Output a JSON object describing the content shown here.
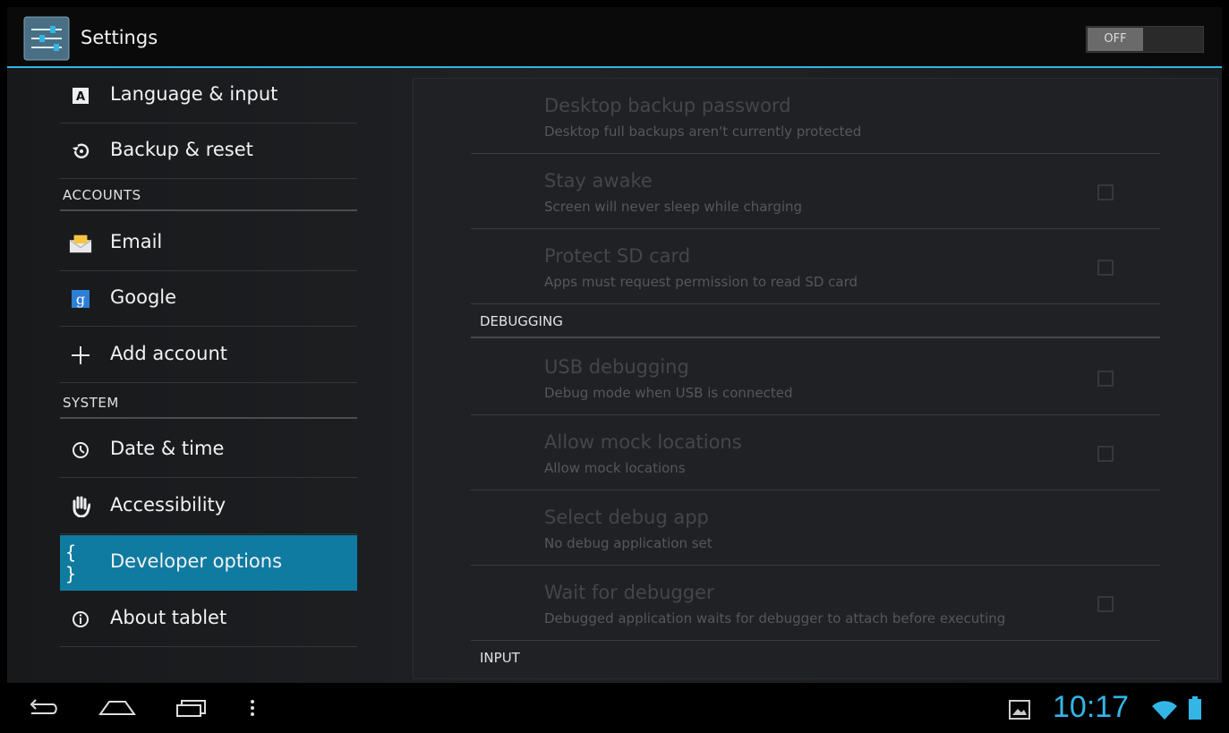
{
  "app": {
    "title": "Settings",
    "master_switch": "OFF"
  },
  "sidebar": {
    "items": [
      {
        "label": "Language & input",
        "icon": "language-icon"
      },
      {
        "label": "Backup & reset",
        "icon": "backup-icon"
      },
      {
        "header": "ACCOUNTS"
      },
      {
        "label": "Email",
        "icon": "email-icon"
      },
      {
        "label": "Google",
        "icon": "google-icon"
      },
      {
        "label": "Add account",
        "icon": "plus-icon"
      },
      {
        "header": "SYSTEM"
      },
      {
        "label": "Date & time",
        "icon": "clock-icon"
      },
      {
        "label": "Accessibility",
        "icon": "hand-icon"
      },
      {
        "label": "Developer options",
        "icon": "braces-icon",
        "selected": true
      },
      {
        "label": "About tablet",
        "icon": "info-icon"
      }
    ]
  },
  "detail": {
    "prefs": [
      {
        "title": "Desktop backup password",
        "summary": "Desktop full backups aren't currently protected",
        "checkbox": false
      },
      {
        "title": "Stay awake",
        "summary": "Screen will never sleep while charging",
        "checkbox": true,
        "checked": false
      },
      {
        "title": "Protect SD card",
        "summary": "Apps must request permission to read SD card",
        "checkbox": true,
        "checked": false
      }
    ],
    "debug_header": "DEBUGGING",
    "debug_prefs": [
      {
        "title": "USB debugging",
        "summary": "Debug mode when USB is connected",
        "checkbox": true,
        "checked": false
      },
      {
        "title": "Allow mock locations",
        "summary": "Allow mock locations",
        "checkbox": true,
        "checked": false
      },
      {
        "title": "Select debug app",
        "summary": "No debug application set",
        "checkbox": false
      },
      {
        "title": "Wait for debugger",
        "summary": "Debugged application waits for debugger to attach before executing",
        "checkbox": true,
        "checked": false
      }
    ],
    "input_header": "INPUT"
  },
  "statusbar": {
    "time": "10:17"
  },
  "colors": {
    "accent": "#33b5e5",
    "selected": "#0f7ba1"
  }
}
